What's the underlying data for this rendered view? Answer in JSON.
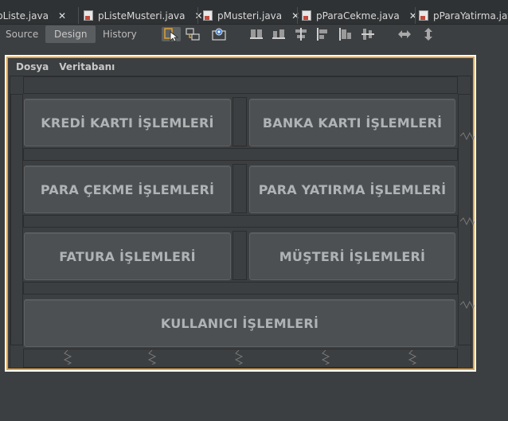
{
  "tabs": [
    {
      "label": "pListe.java",
      "close": "✕"
    },
    {
      "label": "pListeMusteri.java",
      "close": "✕"
    },
    {
      "label": "pMusteri.java",
      "close": "✕"
    },
    {
      "label": "pParaCekme.java",
      "close": "✕"
    },
    {
      "label": "pParaYatirma.java",
      "close": ""
    }
  ],
  "toolbar": {
    "modes": [
      {
        "label": "Source",
        "active": false
      },
      {
        "label": "Design",
        "active": true
      },
      {
        "label": "History",
        "active": false
      }
    ],
    "icons": [
      "selection-mode-icon",
      "connection-mode-icon",
      "preview-design-icon",
      "align-left-icon",
      "align-right-icon",
      "center-horizontally-icon",
      "align-top-icon",
      "align-bottom-icon",
      "center-vertically-icon",
      "change-horizontal-resizability-icon",
      "change-vertical-resizability-icon"
    ]
  },
  "form": {
    "menu": [
      "Dosya",
      "Veritabanı"
    ],
    "buttons": [
      "KREDİ KARTI İŞLEMLERİ",
      "BANKA KARTI İŞLEMLERİ",
      "PARA ÇEKME İŞLEMLERİ",
      "PARA YATIRMA İŞLEMLERİ",
      "FATURA İŞLEMLERİ",
      "MÜŞTERİ İŞLEMLERİ",
      "KULLANICI İŞLEMLERİ"
    ],
    "border_colors": {
      "selection": "#e8a33c",
      "outline": "#ffffff"
    }
  }
}
